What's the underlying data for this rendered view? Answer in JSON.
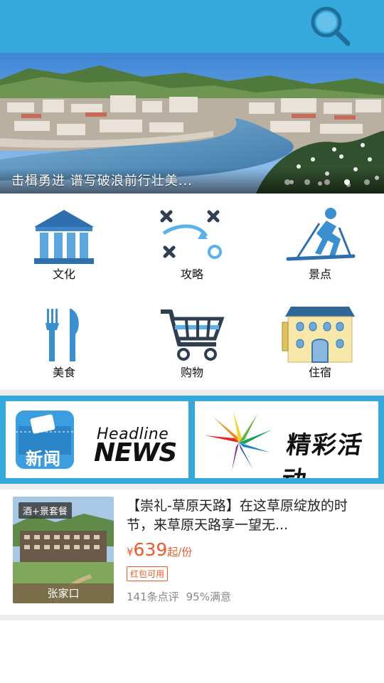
{
  "header": {
    "search_icon": "search-icon",
    "bg_color": "#36a9dc"
  },
  "banner": {
    "caption": "击楫勇进 谱写破浪前行壮美...",
    "dot_count": 5,
    "active_dot": 4
  },
  "categories": [
    {
      "label": "文化",
      "icon": "museum-icon"
    },
    {
      "label": "攻略",
      "icon": "strategy-icon"
    },
    {
      "label": "景点",
      "icon": "skier-icon"
    },
    {
      "label": "美食",
      "icon": "fork-knife-icon"
    },
    {
      "label": "购物",
      "icon": "shopping-cart-icon"
    },
    {
      "label": "住宿",
      "icon": "hotel-icon"
    }
  ],
  "promos": {
    "news": {
      "badge": "新闻",
      "headline": "Headline",
      "news": "NEWS"
    },
    "activity": {
      "title": "精彩活动"
    }
  },
  "product": {
    "tag": "酒+景套餐",
    "city": "张家口",
    "title": "【崇礼-草原天路】在这草原绽放的时节，来草原天路享一望无...",
    "currency": "¥",
    "price": "639",
    "price_unit": "起/份",
    "badge": "红包可用",
    "reviews": "141条点评",
    "satisfaction": "95%满意"
  },
  "colors": {
    "accent": "#36a9dc",
    "price": "#f05a28",
    "icon_blue": "#3a8fd0"
  }
}
